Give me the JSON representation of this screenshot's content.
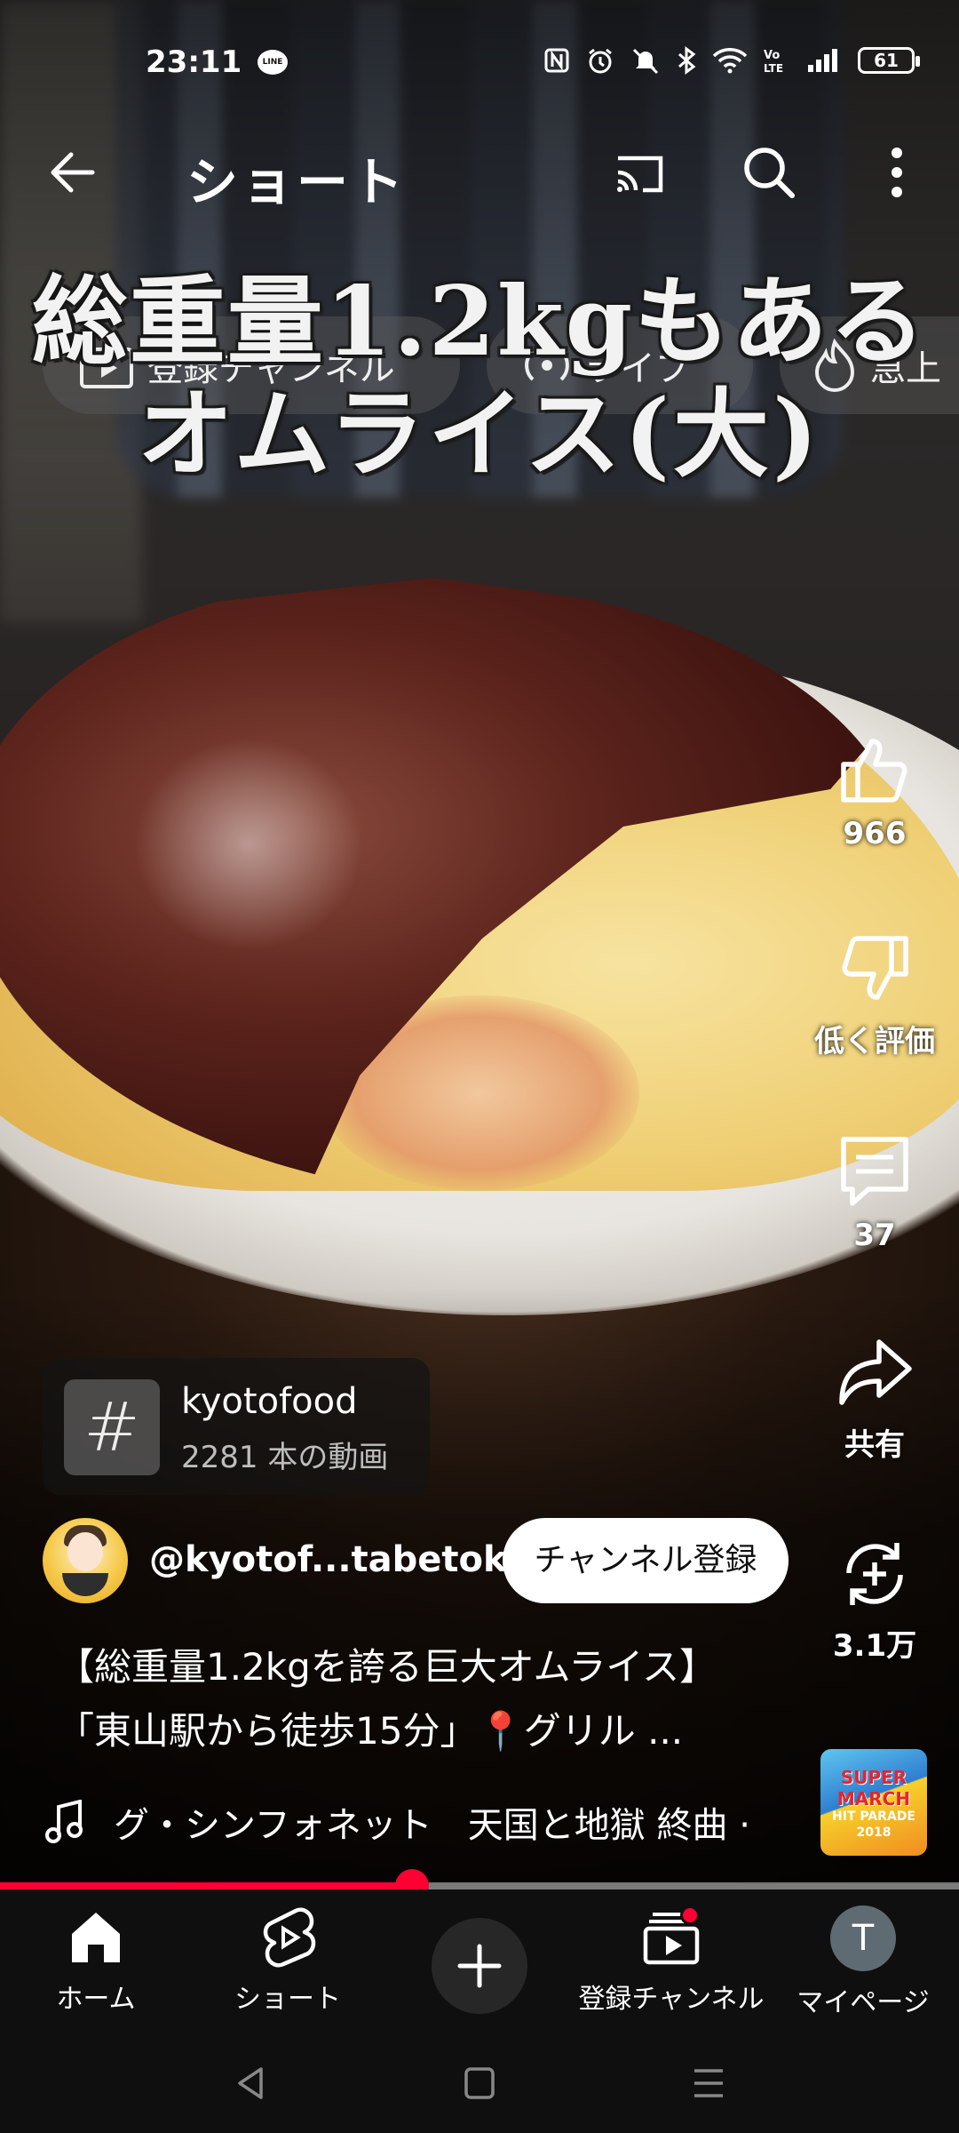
{
  "status_bar": {
    "time": "23:11",
    "line_badge": "LINE",
    "battery": "61"
  },
  "app_bar": {
    "title": "ショート"
  },
  "chips": [
    {
      "label": "登録チャンネル",
      "icon": "subscriptions-icon"
    },
    {
      "label": "ライブ",
      "icon": "live-icon"
    },
    {
      "label": "急上",
      "icon": "trending-icon"
    }
  ],
  "caption": {
    "line1": "総重量1.2kgもある",
    "line2": "オムライス(大)"
  },
  "actions": {
    "like_count": "966",
    "dislike_label": "低く評価",
    "comments_count": "37",
    "share_label": "共有",
    "remix_count": "3.1万"
  },
  "hashtag": {
    "symbol": "#",
    "name": "kyotofood",
    "count": "2281 本の動画"
  },
  "channel": {
    "handle": "@kyotof...tabetoku",
    "subscribe_label": "チャンネル登録"
  },
  "description": {
    "line1": "【総重量1.2kgを誇る巨大オムライス】",
    "line2": "「東山駅から徒歩15分」📍グリル ..."
  },
  "music": {
    "text": "グ・シンフォネット　天国と地獄 終曲 ·",
    "album_line1": "SUPER",
    "album_line2": "MARCH",
    "album_line3": "HIT PARADE",
    "album_line4": "2018"
  },
  "progress": {
    "fraction": 0.43
  },
  "nav": {
    "home": "ホーム",
    "shorts": "ショート",
    "subscriptions": "登録チャンネル",
    "mypage": "マイページ",
    "avatar_letter": "T"
  },
  "colors": {
    "accent": "#ff0033",
    "background": "#0f0f0f"
  }
}
